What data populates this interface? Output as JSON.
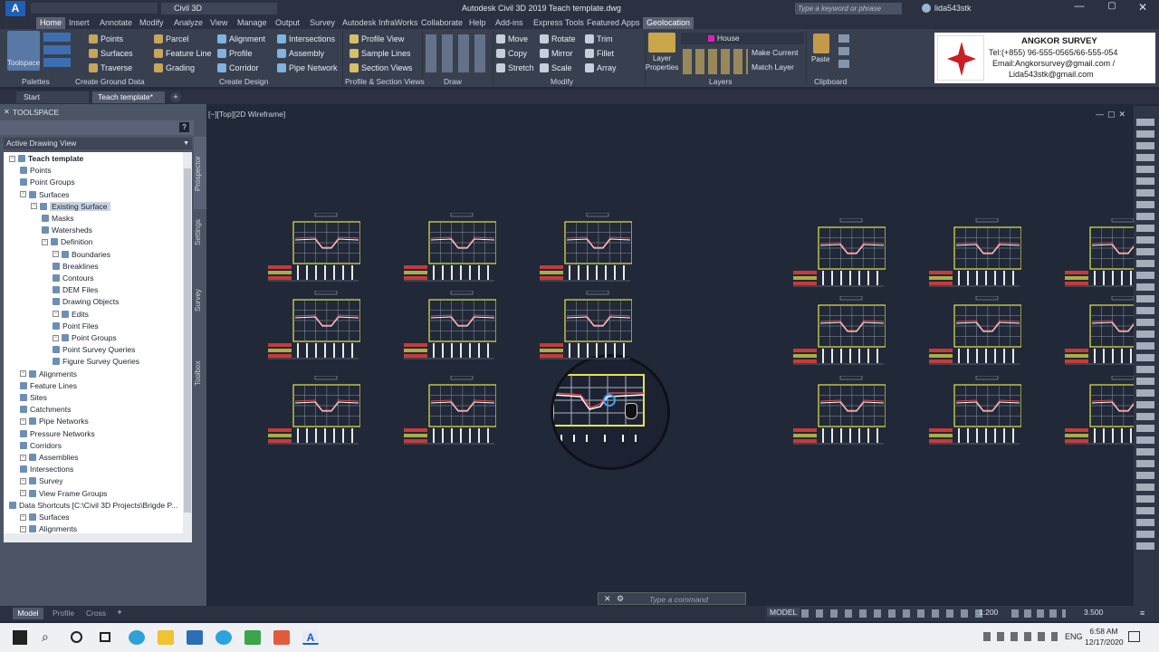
{
  "app": {
    "title": "Autodesk Civil 3D 2019   Teach template.dwg",
    "workspace": "Civil 3D",
    "search_placeholder": "Type a keyword or phrase",
    "user": "lida543stk"
  },
  "menu_tabs": [
    "Home",
    "Insert",
    "Annotate",
    "Modify",
    "Analyze",
    "View",
    "Manage",
    "Output",
    "Survey",
    "Autodesk InfraWorks",
    "Collaborate",
    "Help",
    "Add-ins",
    "Express Tools",
    "Featured Apps",
    "Geolocation"
  ],
  "ribbon": {
    "toolspace": "Toolspace",
    "ground_items": [
      "Points",
      "Surfaces",
      "Traverse",
      "Parcel",
      "Feature Line",
      "Grading"
    ],
    "design_items": [
      "Alignment",
      "Profile",
      "Corridor",
      "Intersections",
      "Assembly",
      "Pipe Network"
    ],
    "profile_items": [
      "Profile View",
      "Sample Lines",
      "Section Views"
    ],
    "modify_items": [
      "Move",
      "Copy",
      "Stretch",
      "Rotate",
      "Mirror",
      "Scale",
      "Trim",
      "Fillet",
      "Array"
    ],
    "layer_props": "Layer Properties",
    "layer_current": "House",
    "layer_items": [
      "Make Current",
      "Match Layer"
    ],
    "paste": "Paste",
    "groups": [
      "Palettes",
      "Create Ground Data",
      "Create Design",
      "Profile & Section Views",
      "Draw",
      "Modify",
      "Layers",
      "Clipboard"
    ]
  },
  "brand": {
    "name": "ANGKOR SURVEY",
    "tel": "Tel:(+855) 96-555-0565/66-555-054",
    "email": "Email:Angkorsurvey@gmail.com /",
    "email2": "Lida543stk@gmail.com"
  },
  "doc_tabs": [
    "Start",
    "Teach template*"
  ],
  "toolspace": {
    "title": "TOOLSPACE",
    "view": "Active Drawing View",
    "side_tabs": [
      "Prospector",
      "Settings",
      "Survey",
      "Toolbox"
    ],
    "tree": [
      {
        "label": "Teach template",
        "level": 0,
        "bold": true
      },
      {
        "label": "Points",
        "level": 1
      },
      {
        "label": "Point Groups",
        "level": 1
      },
      {
        "label": "Surfaces",
        "level": 1
      },
      {
        "label": "Existing Surface",
        "level": 2,
        "selected": true
      },
      {
        "label": "Masks",
        "level": 3
      },
      {
        "label": "Watersheds",
        "level": 3
      },
      {
        "label": "Definition",
        "level": 3
      },
      {
        "label": "Boundaries",
        "level": 4
      },
      {
        "label": "Breaklines",
        "level": 4
      },
      {
        "label": "Contours",
        "level": 4
      },
      {
        "label": "DEM Files",
        "level": 4
      },
      {
        "label": "Drawing Objects",
        "level": 4
      },
      {
        "label": "Edits",
        "level": 4
      },
      {
        "label": "Point Files",
        "level": 4
      },
      {
        "label": "Point Groups",
        "level": 4
      },
      {
        "label": "Point Survey Queries",
        "level": 4
      },
      {
        "label": "Figure Survey Queries",
        "level": 4
      },
      {
        "label": "Alignments",
        "level": 1
      },
      {
        "label": "Feature Lines",
        "level": 1
      },
      {
        "label": "Sites",
        "level": 1
      },
      {
        "label": "Catchments",
        "level": 1
      },
      {
        "label": "Pipe Networks",
        "level": 1
      },
      {
        "label": "Pressure Networks",
        "level": 1
      },
      {
        "label": "Corridors",
        "level": 1
      },
      {
        "label": "Assemblies",
        "level": 1
      },
      {
        "label": "Intersections",
        "level": 1
      },
      {
        "label": "Survey",
        "level": 1
      },
      {
        "label": "View Frame Groups",
        "level": 1
      },
      {
        "label": "Data Shortcuts [C:\\Civil 3D Projects\\Brigde P...",
        "level": 0
      },
      {
        "label": "Surfaces",
        "level": 1
      },
      {
        "label": "Alignments",
        "level": 1
      }
    ]
  },
  "viewport_label": "[−][Top][2D Wireframe]",
  "command_placeholder": "Type a command",
  "layout_tabs": [
    "Model",
    "Profile",
    "Cross"
  ],
  "status": {
    "model": "MODEL",
    "scale": "1:200",
    "elev": "3.500"
  },
  "taskbar": {
    "time": "6:58 AM",
    "date": "12/17/2020",
    "lang": "ENG"
  }
}
